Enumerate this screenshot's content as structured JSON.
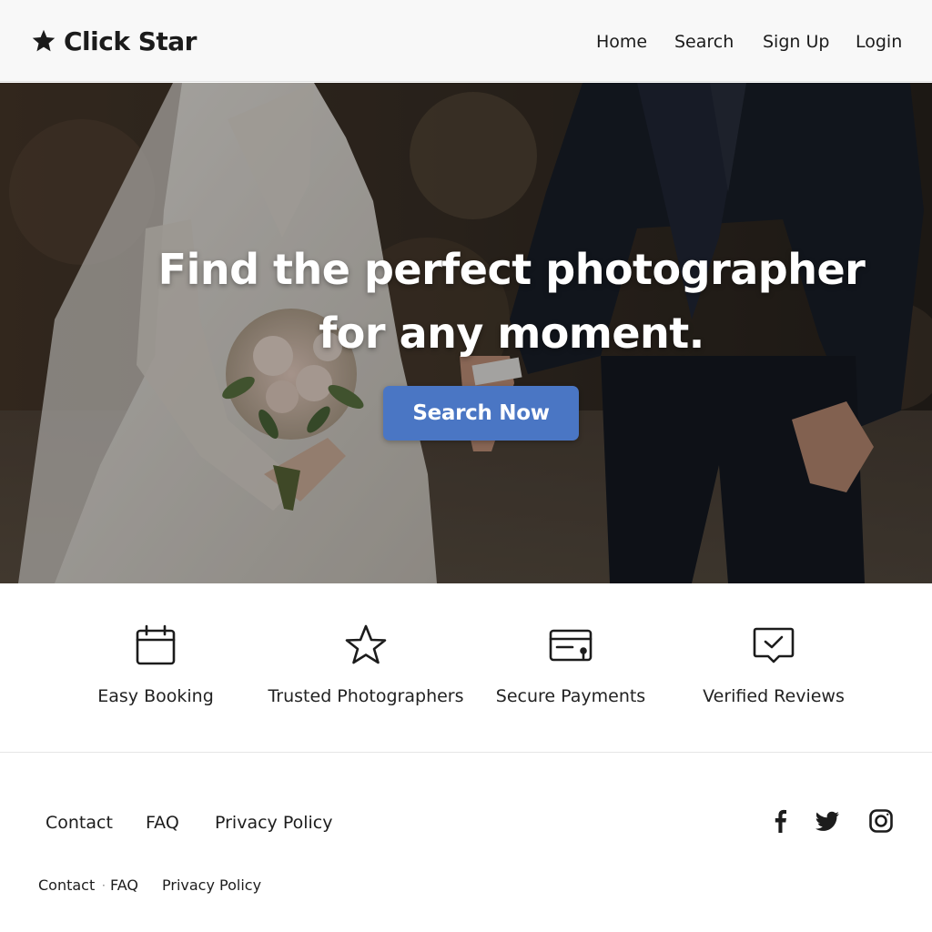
{
  "brand": {
    "name": "Click Star",
    "icon": "star-icon"
  },
  "nav": {
    "home": "Home",
    "search": "Search",
    "signup": "Sign Up",
    "login": "Login"
  },
  "hero": {
    "title_line1": "Find the perfect photographer",
    "title_line2": "for any moment.",
    "cta": "Search Now",
    "image": "wedding-couple-photo"
  },
  "features": [
    {
      "icon": "calendar-icon",
      "label": "Easy Booking"
    },
    {
      "icon": "star-outline-icon",
      "label": "Trusted Photographers"
    },
    {
      "icon": "credit-card-icon",
      "label": "Secure Payments"
    },
    {
      "icon": "message-check-icon",
      "label": "Verified Reviews"
    }
  ],
  "footer": {
    "links": [
      "Contact",
      "FAQ",
      "Privacy Policy"
    ],
    "secondary_links": [
      "Contact",
      "FAQ",
      "Privacy Policy"
    ],
    "social": [
      "facebook-icon",
      "twitter-icon",
      "instagram-icon"
    ]
  },
  "colors": {
    "accent": "#4a76c4",
    "header_bg": "#f8f8f8",
    "text": "#1c1c1c"
  }
}
